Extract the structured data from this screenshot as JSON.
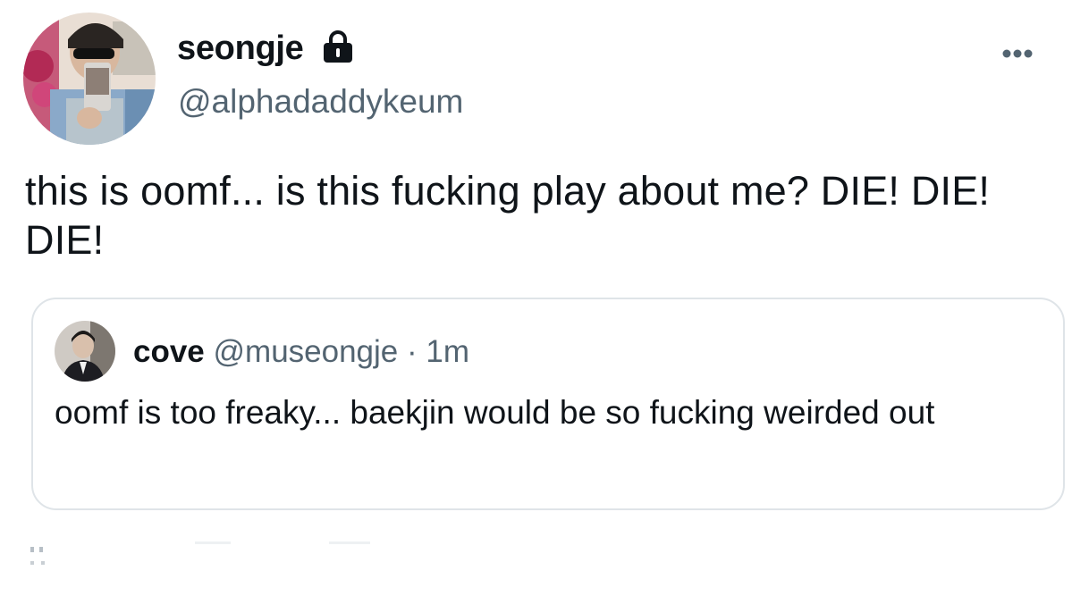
{
  "author": {
    "display_name": "seongje",
    "handle": "@alphadaddykeum",
    "protected": true,
    "lock_icon": "lock-icon",
    "more_icon": "more-horizontal-icon"
  },
  "tweet": {
    "text": "this is oomf... is this fucking play about me? DIE! DIE! DIE!"
  },
  "quote": {
    "display_name": "cove",
    "handle": "@museongje",
    "separator": "·",
    "time": "1m",
    "text": "oomf is too freaky... baekjin would be so fucking weirded out"
  },
  "colors": {
    "primary_text": "#0f1419",
    "secondary_text": "#536471",
    "border": "#dfe4e8"
  }
}
